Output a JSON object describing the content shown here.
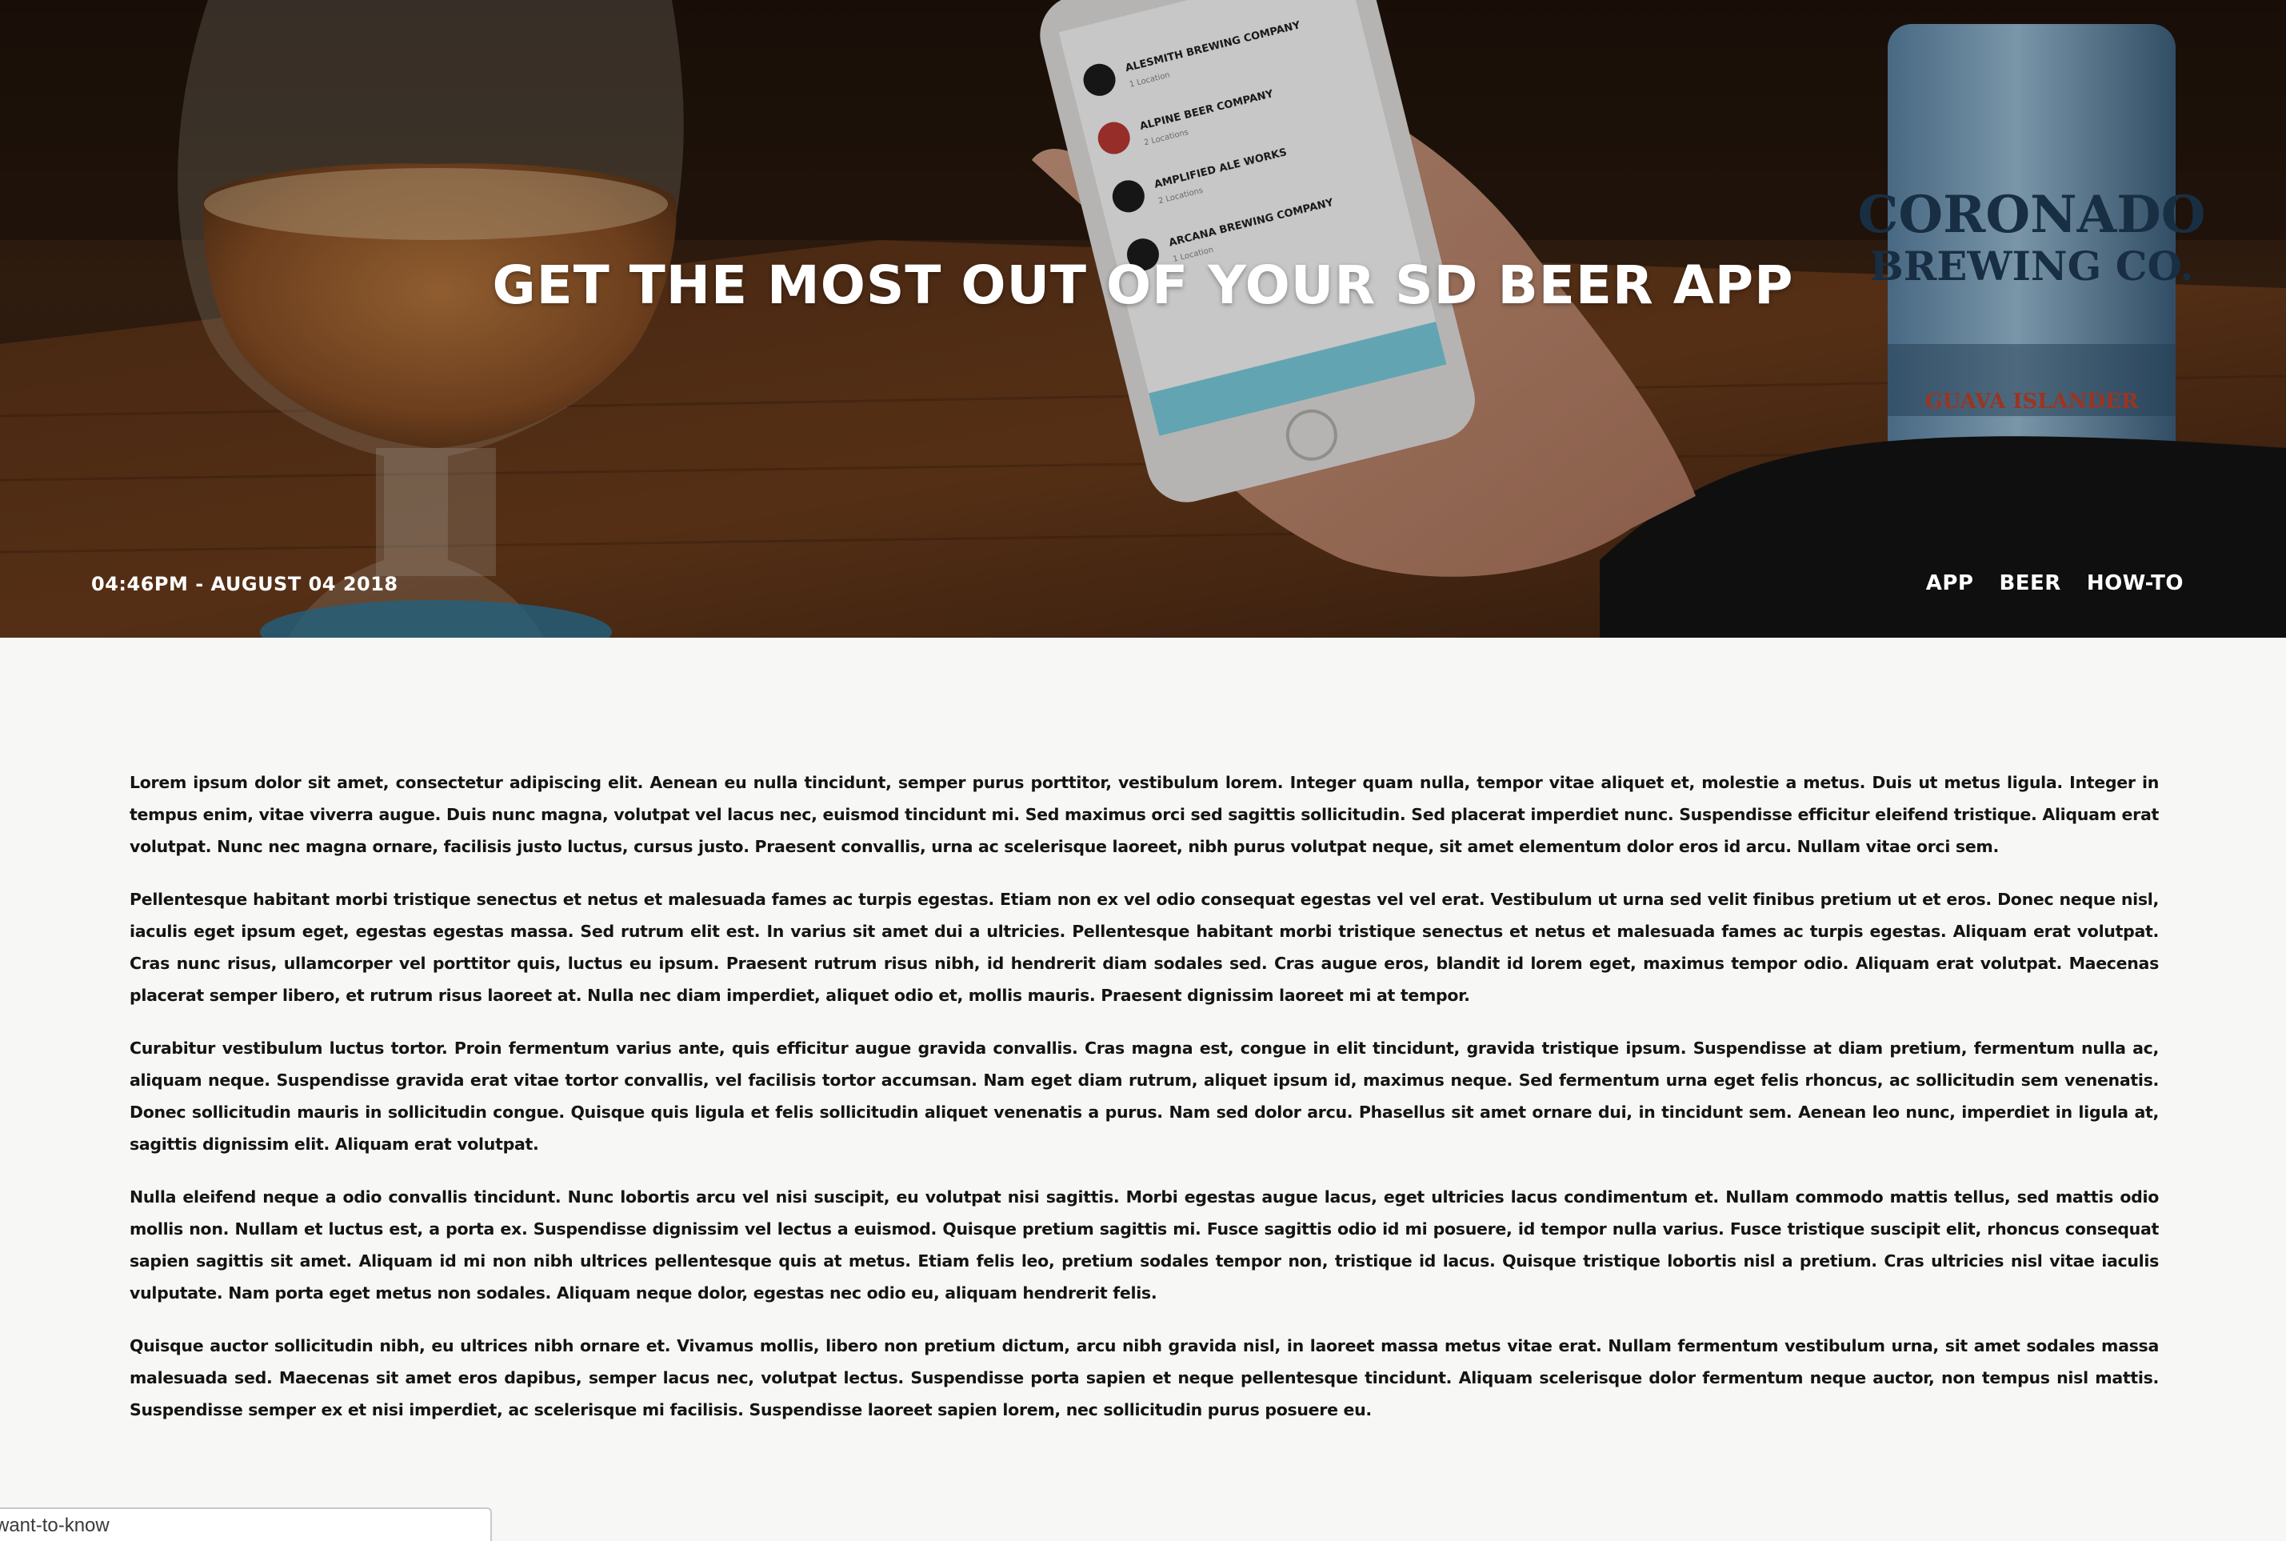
{
  "hero": {
    "title": "GET THE MOST OUT OF YOUR SD BEER APP",
    "date": "04:46PM - AUGUST 04 2018",
    "tags": [
      "APP",
      "BEER",
      "HOW-TO"
    ],
    "phone_list": [
      {
        "name": "ALESMITH BREWING COMPANY",
        "sub": "1 Location"
      },
      {
        "name": "ALPINE BEER COMPANY",
        "sub": "2 Locations"
      },
      {
        "name": "AMPLIFIED ALE WORKS",
        "sub": "2 Locations"
      },
      {
        "name": "ARCANA BREWING COMPANY",
        "sub": "1 Location"
      }
    ],
    "can_brand": "CORONADO",
    "can_brand_line2": "BREWING CO.",
    "can_label": "GUAVA ISLANDER"
  },
  "article": {
    "paragraphs": [
      "Lorem ipsum dolor sit amet, consectetur adipiscing elit. Aenean eu nulla tincidunt, semper purus porttitor, vestibulum lorem. Integer quam nulla, tempor vitae aliquet et, molestie a metus. Duis ut metus ligula. Integer in tempus enim, vitae viverra augue. Duis nunc magna, volutpat vel lacus nec, euismod tincidunt mi. Sed maximus orci sed sagittis sollicitudin. Sed placerat imperdiet nunc. Suspendisse efficitur eleifend tristique. Aliquam erat volutpat. Nunc nec magna ornare, facilisis justo luctus, cursus justo. Praesent convallis, urna ac scelerisque laoreet, nibh purus volutpat neque, sit amet elementum dolor eros id arcu. Nullam vitae orci sem.",
      "Pellentesque habitant morbi tristique senectus et netus et malesuada fames ac turpis egestas. Etiam non ex vel odio consequat egestas vel vel erat. Vestibulum ut urna sed velit finibus pretium ut et eros. Donec neque nisl, iaculis eget ipsum eget, egestas egestas massa. Sed rutrum elit est. In varius sit amet dui a ultricies. Pellentesque habitant morbi tristique senectus et netus et malesuada fames ac turpis egestas. Aliquam erat volutpat. Cras nunc risus, ullamcorper vel porttitor quis, luctus eu ipsum. Praesent rutrum risus nibh, id hendrerit diam sodales sed. Cras augue eros, blandit id lorem eget, maximus tempor odio. Aliquam erat volutpat. Maecenas placerat semper libero, et rutrum risus laoreet at. Nulla nec diam imperdiet, aliquet odio et, mollis mauris. Praesent dignissim laoreet mi at tempor.",
      "Curabitur vestibulum luctus tortor. Proin fermentum varius ante, quis efficitur augue gravida convallis. Cras magna est, congue in elit tincidunt, gravida tristique ipsum. Suspendisse at diam pretium, fermentum nulla ac, aliquam neque. Suspendisse gravida erat vitae tortor convallis, vel facilisis tortor accumsan. Nam eget diam rutrum, aliquet ipsum id, maximus neque. Sed fermentum urna eget felis rhoncus, ac sollicitudin sem venenatis. Donec sollicitudin mauris in sollicitudin congue. Quisque quis ligula et felis sollicitudin aliquet venenatis a purus. Nam sed dolor arcu. Phasellus sit amet ornare dui, in tincidunt sem. Aenean leo nunc, imperdiet in ligula at, sagittis dignissim elit. Aliquam erat volutpat.",
      "Nulla eleifend neque a odio convallis tincidunt. Nunc lobortis arcu vel nisi suscipit, eu volutpat nisi sagittis. Morbi egestas augue lacus, eget ultricies lacus condimentum et. Nullam commodo mattis tellus, sed mattis odio mollis non. Nullam et luctus est, a porta ex. Suspendisse dignissim vel lectus a euismod. Quisque pretium sagittis mi. Fusce sagittis odio id mi posuere, id tempor nulla varius. Fusce tristique suscipit elit, rhoncus consequat sapien sagittis sit amet. Aliquam id mi non nibh ultrices pellentesque quis at metus. Etiam felis leo, pretium sodales tempor non, tristique id lacus. Quisque tristique lobortis nisl a pretium. Cras ultricies nisl vitae iaculis vulputate. Nam porta eget metus non sodales. Aliquam neque dolor, egestas nec odio eu, aliquam hendrerit felis.",
      "Quisque auctor sollicitudin nibh, eu ultrices nibh ornare et. Vivamus mollis, libero non pretium dictum, arcu nibh gravida nisl, in laoreet massa metus vitae erat. Nullam fermentum vestibulum urna, sit amet sodales massa malesuada sed. Maecenas sit amet eros dapibus, semper lacus nec, volutpat lectus. Suspendisse porta sapien et neque pellentesque tincidunt. Aliquam scelerisque dolor fermentum neque auctor, non tempus nisl mattis. Suspendisse semper ex et nisi imperdiet, ac scelerisque mi facilisis. Suspendisse laoreet sapien lorem, nec sollicitudin purus posuere eu."
    ]
  },
  "status_bar": {
    "url_text": "want-to-know"
  },
  "colors": {
    "page_background": "#f7f7f6",
    "body_text": "#141414",
    "hero_text": "#ffffff",
    "phone_accent": "#7fd3e6"
  }
}
